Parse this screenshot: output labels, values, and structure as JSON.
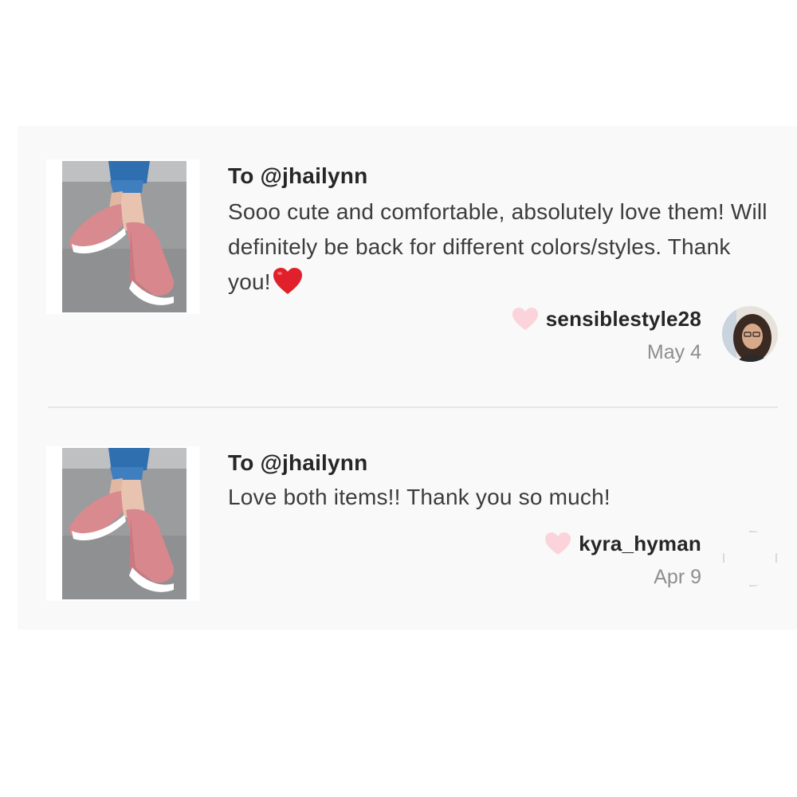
{
  "reviews": [
    {
      "to": "To @jhailynn",
      "message": "Sooo cute and comfortable, absolutely love them! Will definitely be back for different colors/styles. Thank you!",
      "emoji": "heart-emoji",
      "username": "sensiblestyle28",
      "date": "May 4",
      "like_icon": "heart-outline-icon",
      "like_color": "#fbd3da"
    },
    {
      "to": "To @jhailynn",
      "message": "Love both items!! Thank you so much!",
      "username": "kyra_hyman",
      "date": "Apr 9",
      "like_icon": "heart-outline-icon",
      "like_color": "#fbd3da"
    }
  ],
  "colors": {
    "panel_bg": "#f9f9f9",
    "text_primary": "#262626",
    "text_secondary": "#3c3c3c",
    "date": "#8e8e8e",
    "emoji_heart": "#e0202b"
  }
}
